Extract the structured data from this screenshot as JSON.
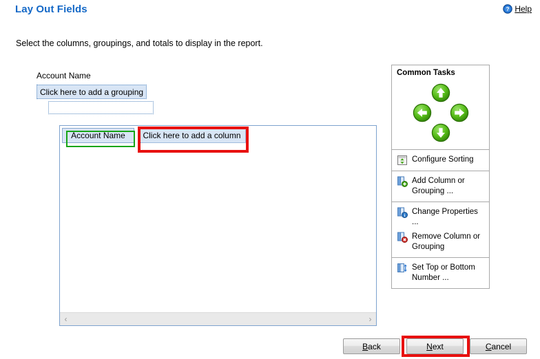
{
  "header": {
    "title": "Lay Out Fields",
    "help_label": "Help",
    "help_accel": "H",
    "help_icon": "help-circle-icon"
  },
  "subtitle": "Select the columns, groupings, and totals to display in the report.",
  "grouping": {
    "label": "Account Name",
    "add_grouping_text": "Click here to add a grouping",
    "empty_box_text": ""
  },
  "designer": {
    "columns": [
      {
        "label": "Account Name",
        "highlight": "green"
      },
      {
        "label": "Click here to add a column",
        "highlight": "red"
      }
    ],
    "scrollbar": {
      "left_arrow": "‹",
      "right_arrow": "›"
    }
  },
  "common_tasks": {
    "title": "Common Tasks",
    "nav_buttons": [
      {
        "name": "move-up-button",
        "icon": "arrow-up-icon"
      },
      {
        "name": "move-left-button",
        "icon": "arrow-left-icon"
      },
      {
        "name": "move-right-button",
        "icon": "arrow-right-icon"
      },
      {
        "name": "move-down-button",
        "icon": "arrow-down-icon"
      }
    ],
    "groups": [
      {
        "items": [
          {
            "label": "Configure Sorting",
            "icon": "sort-icon"
          }
        ]
      },
      {
        "items": [
          {
            "label": "Add Column or Grouping ...",
            "icon": "add-column-icon"
          }
        ]
      },
      {
        "items": [
          {
            "label": "Change Properties ...",
            "icon": "properties-icon"
          },
          {
            "label": "Remove Column or Grouping",
            "icon": "remove-column-icon"
          }
        ]
      },
      {
        "items": [
          {
            "label": "Set Top or Bottom Number ...",
            "icon": "top-bottom-icon"
          }
        ]
      }
    ]
  },
  "footer": {
    "back": {
      "label": "Back",
      "accel": "B"
    },
    "next": {
      "label": "Next",
      "accel": "N"
    },
    "cancel": {
      "label": "Cancel",
      "accel": "C"
    }
  },
  "colors": {
    "title_blue": "#1569C7",
    "annotation_red": "#E8100F",
    "annotation_green": "#17A517",
    "cell_fill": "#D8E5F5",
    "cell_border": "#8BAAD2",
    "panel_border": "#A9A9A9",
    "designer_border": "#7DA2CE",
    "nav_green": "#4CAF16"
  }
}
